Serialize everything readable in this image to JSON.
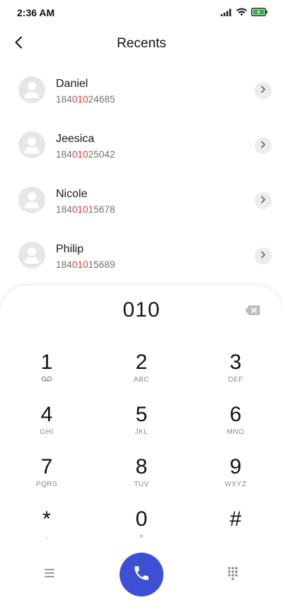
{
  "status_bar": {
    "time": "2:36 AM"
  },
  "header": {
    "title": "Recents"
  },
  "contacts": [
    {
      "name": "Daniel",
      "number_prefix": "184",
      "number_match": "010",
      "number_suffix": "24685"
    },
    {
      "name": "Jeesica",
      "number_prefix": "184",
      "number_match": "010",
      "number_suffix": "25042"
    },
    {
      "name": "Nicole",
      "number_prefix": "184",
      "number_match": "010",
      "number_suffix": "15678"
    },
    {
      "name": "Philip",
      "number_prefix": "184",
      "number_match": "010",
      "number_suffix": "15689"
    }
  ],
  "dialer": {
    "input": "010",
    "keys": [
      {
        "digit": "1",
        "sub": ""
      },
      {
        "digit": "2",
        "sub": "ABC"
      },
      {
        "digit": "3",
        "sub": "DEF"
      },
      {
        "digit": "4",
        "sub": "GHI"
      },
      {
        "digit": "5",
        "sub": "JKL"
      },
      {
        "digit": "6",
        "sub": "MNO"
      },
      {
        "digit": "7",
        "sub": "PQRS"
      },
      {
        "digit": "8",
        "sub": "TUV"
      },
      {
        "digit": "9",
        "sub": "WXYZ"
      },
      {
        "digit": "*",
        "sub": ","
      },
      {
        "digit": "0",
        "sub": "+"
      },
      {
        "digit": "#",
        "sub": ""
      }
    ]
  },
  "colors": {
    "accent": "#3d50d4",
    "highlight": "#e53935"
  },
  "icons": {
    "status": [
      "signal-icon",
      "wifi-icon",
      "battery-charging-icon"
    ],
    "back": "chevron-left-icon",
    "row_action": "chevron-right-icon",
    "delete": "backspace-icon",
    "voicemail": "voicemail-icon",
    "menu": "menu-icon",
    "call": "phone-icon",
    "keypad_toggle": "dialpad-icon"
  }
}
